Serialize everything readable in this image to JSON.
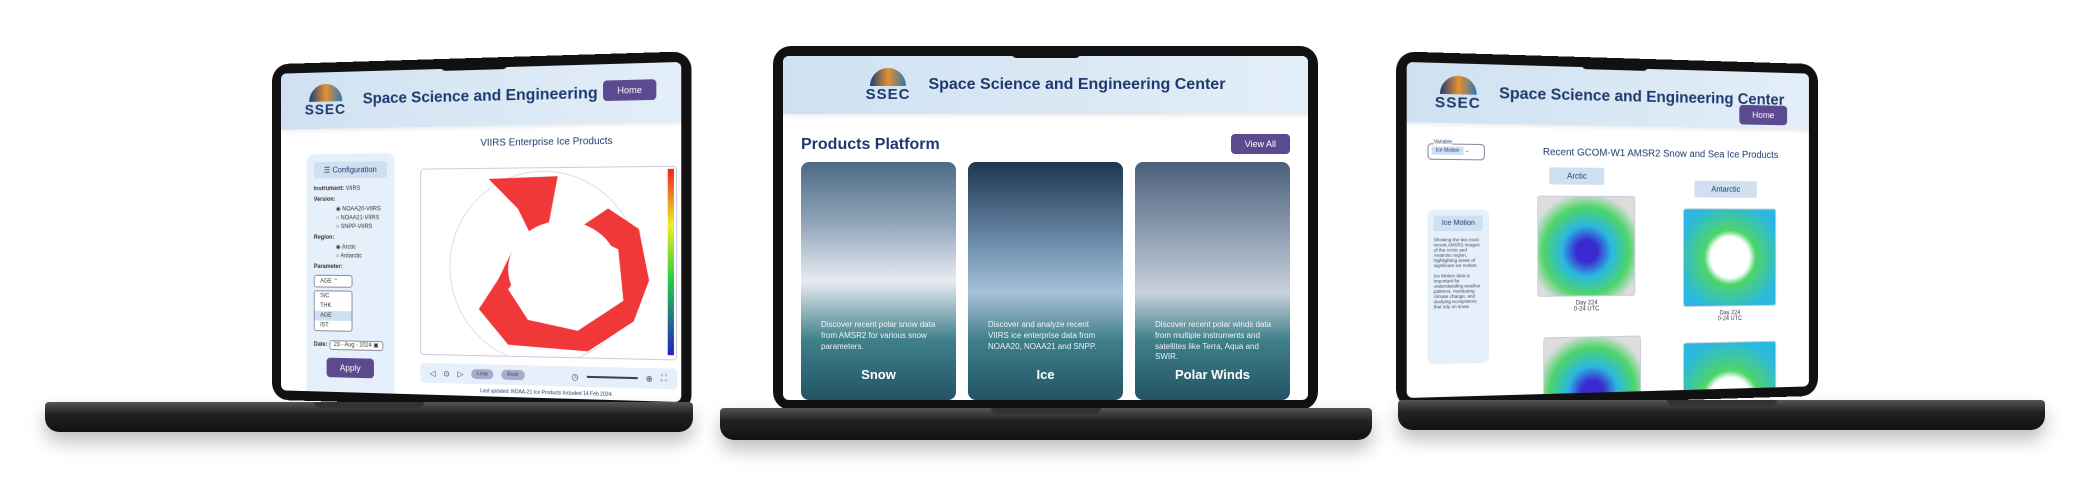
{
  "brand": {
    "logo_text": "SSEC",
    "title": "Space Science and Engineering Center",
    "home_label": "Home"
  },
  "left": {
    "map_title": "VIIRS Enterprise Ice Products",
    "config_title": "Configuration",
    "instrument_label": "Instrument:",
    "instrument_value": "VIIRS",
    "version_label": "Version:",
    "versions": [
      "NOAA20-VIIRS",
      "NOAA21-VIIRS",
      "SNPP-VIIRS"
    ],
    "region_label": "Region:",
    "regions": [
      "Arctic",
      "Antarctic"
    ],
    "parameter_label": "Parameter:",
    "parameter_selected": "AGE",
    "parameter_options": [
      "SIC",
      "THK",
      "AGE",
      "IST"
    ],
    "date_label": "Date:",
    "date_value": "23 - Aug - 2024",
    "apply_label": "Apply",
    "loop_label": "Loop",
    "rock_label": "Rock",
    "footer": "Last updated: NOAA-21 Ice Products Included 14 Feb 2024."
  },
  "middle": {
    "heading": "Products Platform",
    "view_all": "View All",
    "cards": [
      {
        "name": "Snow",
        "desc": "Discover recent polar snow data from AMSR2 for various snow parameters."
      },
      {
        "name": "Ice",
        "desc": "Discover and analyze recent VIIRS ice enterprise data from NOAA20, NOAA21 and SNPP."
      },
      {
        "name": "Polar Winds",
        "desc": "Discover recent polar winds data from multiple instruments and satellites like Terra, Aqua and SWIR."
      }
    ]
  },
  "right": {
    "title": "Recent GCOM-W1 AMSR2 Snow and Sea Ice Products",
    "variable_label": "Variable",
    "variable_value": "Ice Motion",
    "arctic": "Arctic",
    "antarctic": "Antarctic",
    "panel_title": "Ice Motion",
    "panel_text1": "Showing the two most recent AMSR2 images of the Arctic and Antarctic region, highlighting areas of significant ice motion.",
    "panel_text2": "Ice Motion data is important for understanding weather patterns, monitoring climate change, and studying ecosystems that rely on snow.",
    "arctic_caption": [
      "Day 224",
      "0-24 UTC"
    ],
    "antarctic_caption": [
      "Day 224",
      "0-24 UTC"
    ]
  },
  "colors": {
    "accent": "#5b4a8f",
    "header": "#cfe1f1",
    "title": "#1e3a6e"
  }
}
